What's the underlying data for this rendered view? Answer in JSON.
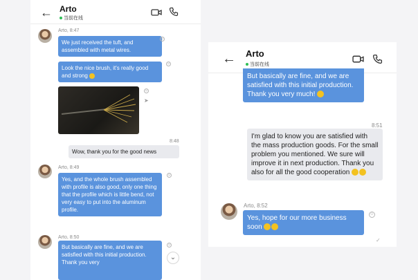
{
  "left": {
    "header": {
      "name": "Arto",
      "status": "当前在线"
    },
    "messages": [
      {
        "meta": "Arto, 8:47",
        "text": "We just received the tuft, and assembled with metal wires."
      },
      {
        "text": "Look the nice brush, it's really good and strong"
      },
      {
        "time": "8:48",
        "text": "Wow, thank you for the good news"
      },
      {
        "meta": "Arto, 8:49",
        "text": "Yes, and the whole brush assembled with profile is also good, only one thing that the profile which is little bend, not very easy to put into the aluminum profile."
      },
      {
        "meta": "Arto, 8:50",
        "text": "But basically are fine, and we are satisfied with this initial production. Thank you very"
      }
    ]
  },
  "right": {
    "header": {
      "name": "Arto",
      "status": "当前在线"
    },
    "messages": [
      {
        "text": "But basically are fine, and we are satisfied with this initial production. Thank you very much!"
      },
      {
        "time": "8:51",
        "text": "I'm glad to know you are satisfied with the mass production goods. For the small problem you mentioned. We sure will improve it in next production. Thank you also for all the good cooperation"
      },
      {
        "meta": "Arto, 8:52",
        "text": "Yes, hope for our more business soon"
      }
    ]
  },
  "icons": {
    "back": "arrow-left-icon",
    "video": "video-camera-icon",
    "phone": "phone-icon"
  }
}
